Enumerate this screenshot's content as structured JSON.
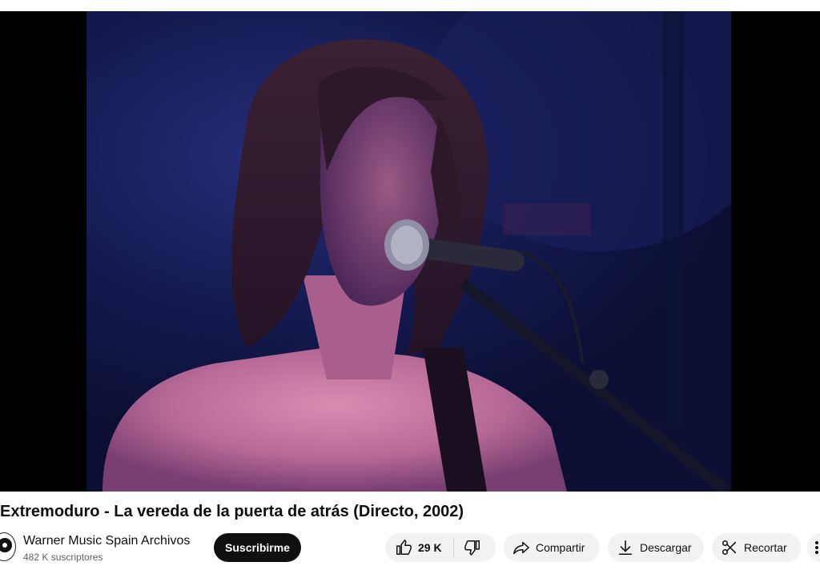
{
  "video": {
    "title": "Extremoduro - La vereda de la puerta de atrás (Directo, 2002)"
  },
  "channel": {
    "name": "Warner Music Spain Archivos",
    "subscribers": "482 K suscriptores",
    "subscribe_label": "Suscribirme"
  },
  "actions": {
    "likes": "29 K",
    "share_label": "Compartir",
    "download_label": "Descargar",
    "clip_label": "Recortar"
  }
}
